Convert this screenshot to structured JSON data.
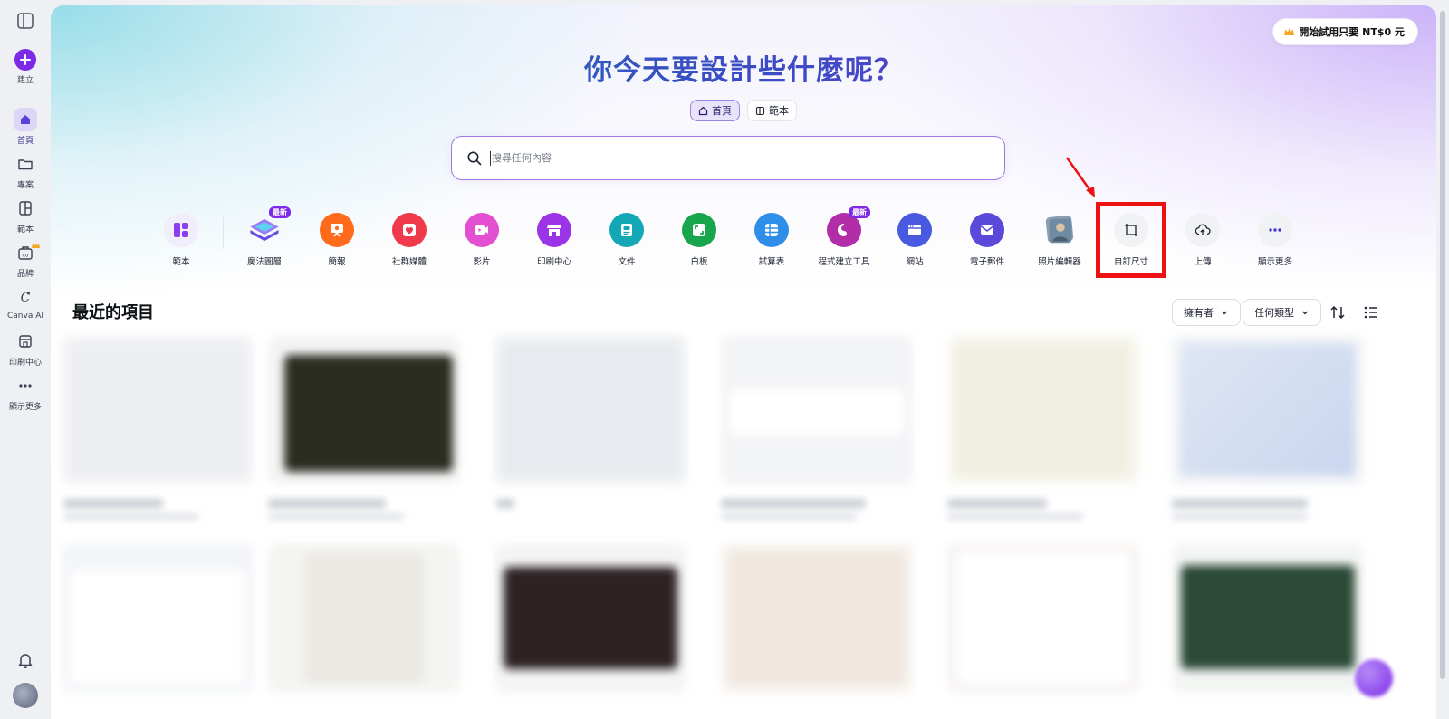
{
  "sidebar": {
    "create": "建立",
    "home": "首頁",
    "projects": "專案",
    "templates": "範本",
    "brand": "品牌",
    "canva_ai": "Canva AI",
    "print": "印刷中心",
    "more": "顯示更多"
  },
  "header": {
    "trial_label": "開始試用只要 NT$0 元",
    "title": "你今天要設計些什麼呢？",
    "tabs": [
      "首頁",
      "範本"
    ],
    "active_tab": "首頁"
  },
  "search": {
    "placeholder": "搜尋任何內容"
  },
  "shortcuts": [
    {
      "label": "範本",
      "icon": "templates-icon",
      "color": "#f0eefa"
    },
    {
      "label": "魔法圖層",
      "icon": "magic-layers-icon",
      "color": "#7b5cf0",
      "badge": "最新"
    },
    {
      "label": "簡報",
      "icon": "presentation-icon",
      "color": "#ff6b1a"
    },
    {
      "label": "社群媒體",
      "icon": "heart-icon",
      "color": "#f0394b"
    },
    {
      "label": "影片",
      "icon": "video-icon",
      "color": "#e24fd1"
    },
    {
      "label": "印刷中心",
      "icon": "store-icon",
      "color": "#9a34e6"
    },
    {
      "label": "文件",
      "icon": "doc-icon",
      "color": "#14a7b6"
    },
    {
      "label": "白板",
      "icon": "whiteboard-icon",
      "color": "#17a64c"
    },
    {
      "label": "試算表",
      "icon": "sheet-icon",
      "color": "#2f8ee8"
    },
    {
      "label": "程式建立工具",
      "icon": "code-tool-icon",
      "color": "#b22ea9",
      "badge": "最新"
    },
    {
      "label": "網站",
      "icon": "website-icon",
      "color": "#4a5ae0"
    },
    {
      "label": "電子郵件",
      "icon": "email-icon",
      "color": "#5b49d9"
    },
    {
      "label": "照片編輯器",
      "icon": "photo-editor-icon",
      "color": "#6f8aa3"
    },
    {
      "label": "自訂尺寸",
      "icon": "custom-size-icon",
      "color": "#f1f2f4"
    },
    {
      "label": "上傳",
      "icon": "upload-icon",
      "color": "#f1f2f4"
    },
    {
      "label": "顯示更多",
      "icon": "more-icon",
      "color": "#f1f2f4"
    }
  ],
  "highlighted_shortcut": "自訂尺寸",
  "recent": {
    "title": "最近的項目",
    "filters": [
      "擁有者",
      "任何類型"
    ]
  },
  "colors": {
    "accent": "#7d2ae8",
    "highlight": "#ee1111"
  }
}
